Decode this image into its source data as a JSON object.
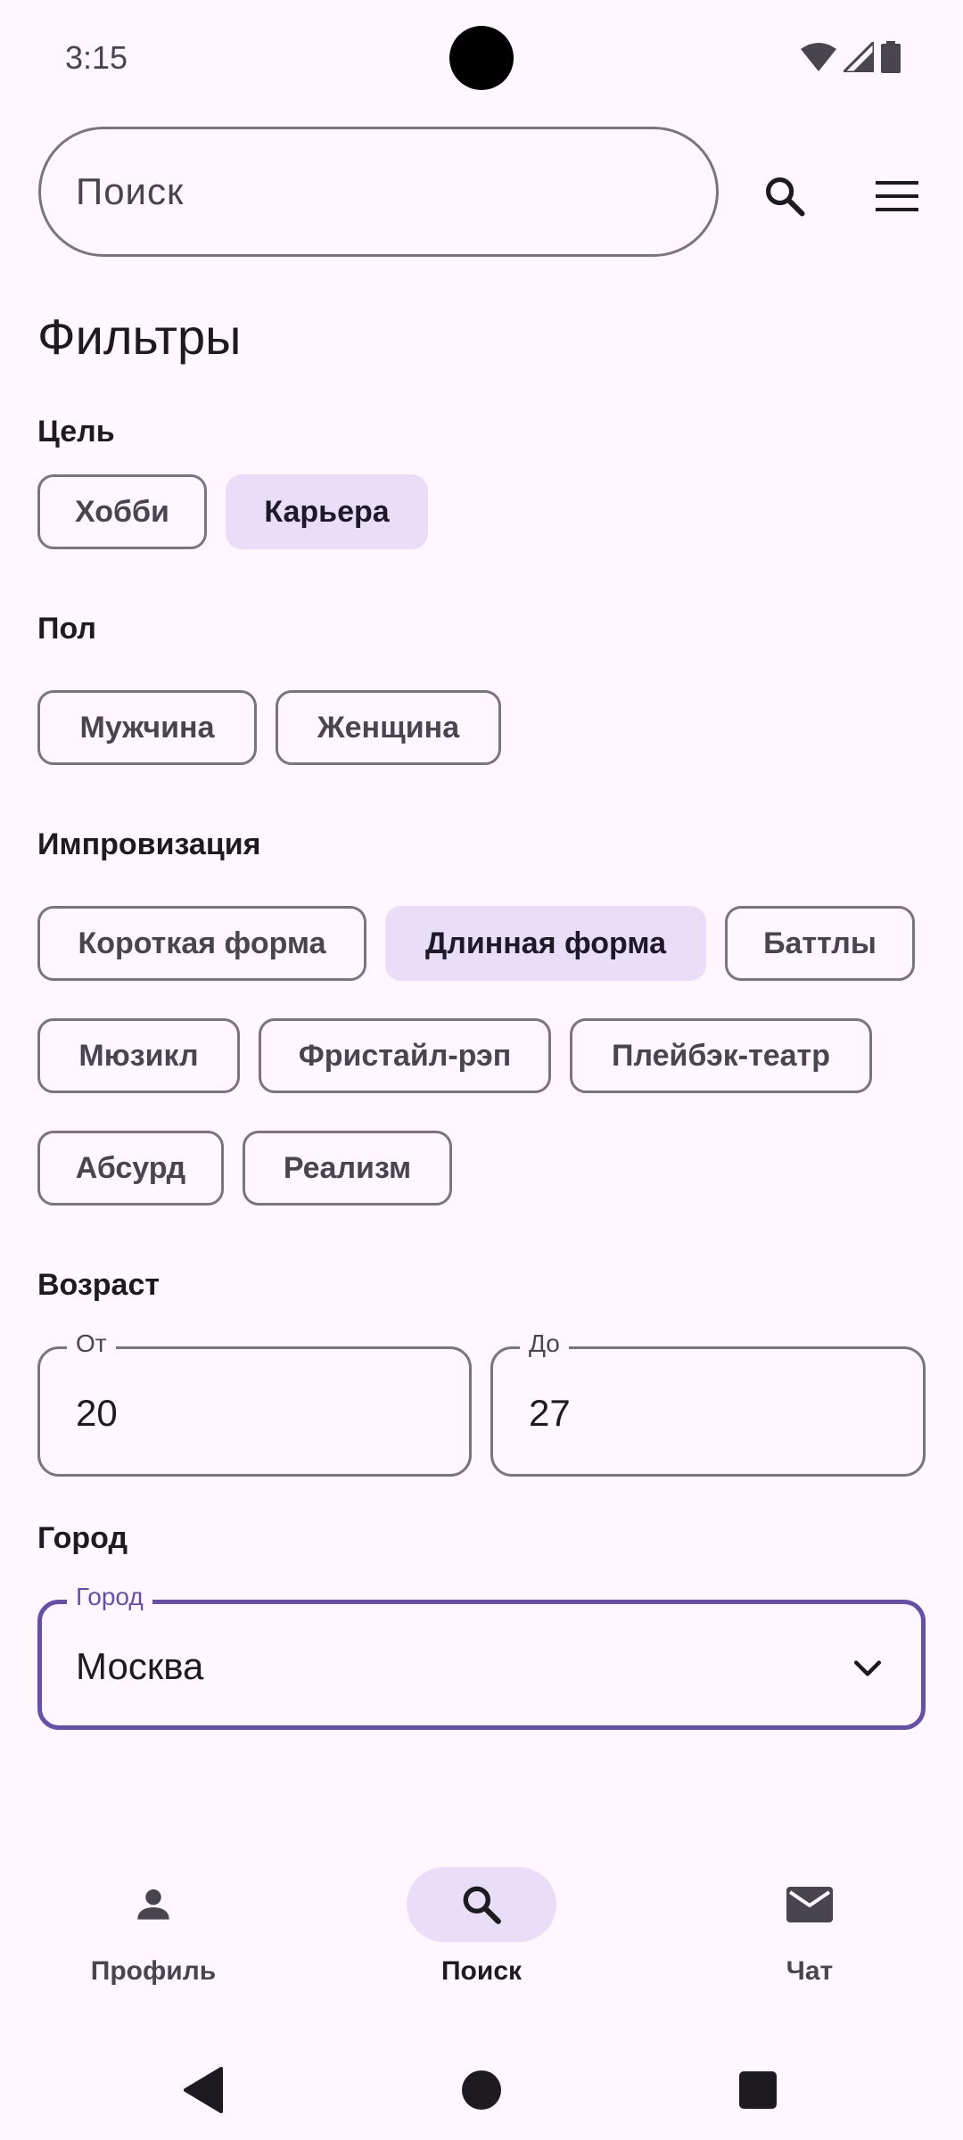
{
  "status_bar": {
    "time": "3:15"
  },
  "search": {
    "placeholder": "Поиск"
  },
  "page_title": "Фильтры",
  "sections": {
    "goal": {
      "label": "Цель",
      "chips": [
        {
          "label": "Хобби",
          "selected": false
        },
        {
          "label": "Карьера",
          "selected": true
        }
      ]
    },
    "gender": {
      "label": "Пол",
      "chips": [
        {
          "label": "Мужчина",
          "selected": false
        },
        {
          "label": "Женщина",
          "selected": false
        }
      ]
    },
    "improv": {
      "label": "Импровизация",
      "chips": [
        {
          "label": "Короткая форма",
          "selected": false
        },
        {
          "label": "Длинная форма",
          "selected": true
        },
        {
          "label": "Баттлы",
          "selected": false
        },
        {
          "label": "Мюзикл",
          "selected": false
        },
        {
          "label": "Фристайл-рэп",
          "selected": false
        },
        {
          "label": "Плейбэк-театр",
          "selected": false
        },
        {
          "label": "Абсурд",
          "selected": false
        },
        {
          "label": "Реализм",
          "selected": false
        }
      ]
    },
    "age": {
      "label": "Возраст",
      "from_label": "От",
      "from_value": "20",
      "to_label": "До",
      "to_value": "27"
    },
    "city": {
      "label": "Город",
      "field_label": "Город",
      "value": "Москва"
    }
  },
  "bottom_nav": {
    "items": [
      {
        "label": "Профиль",
        "icon": "person-icon",
        "active": false
      },
      {
        "label": "Поиск",
        "icon": "search-icon",
        "active": true
      },
      {
        "label": "Чат",
        "icon": "mail-icon",
        "active": false
      }
    ]
  },
  "colors": {
    "background": "#FEF7FF",
    "primary": "#6750A4",
    "selected_chip": "#E8DEF8",
    "outline": "#79747E"
  }
}
